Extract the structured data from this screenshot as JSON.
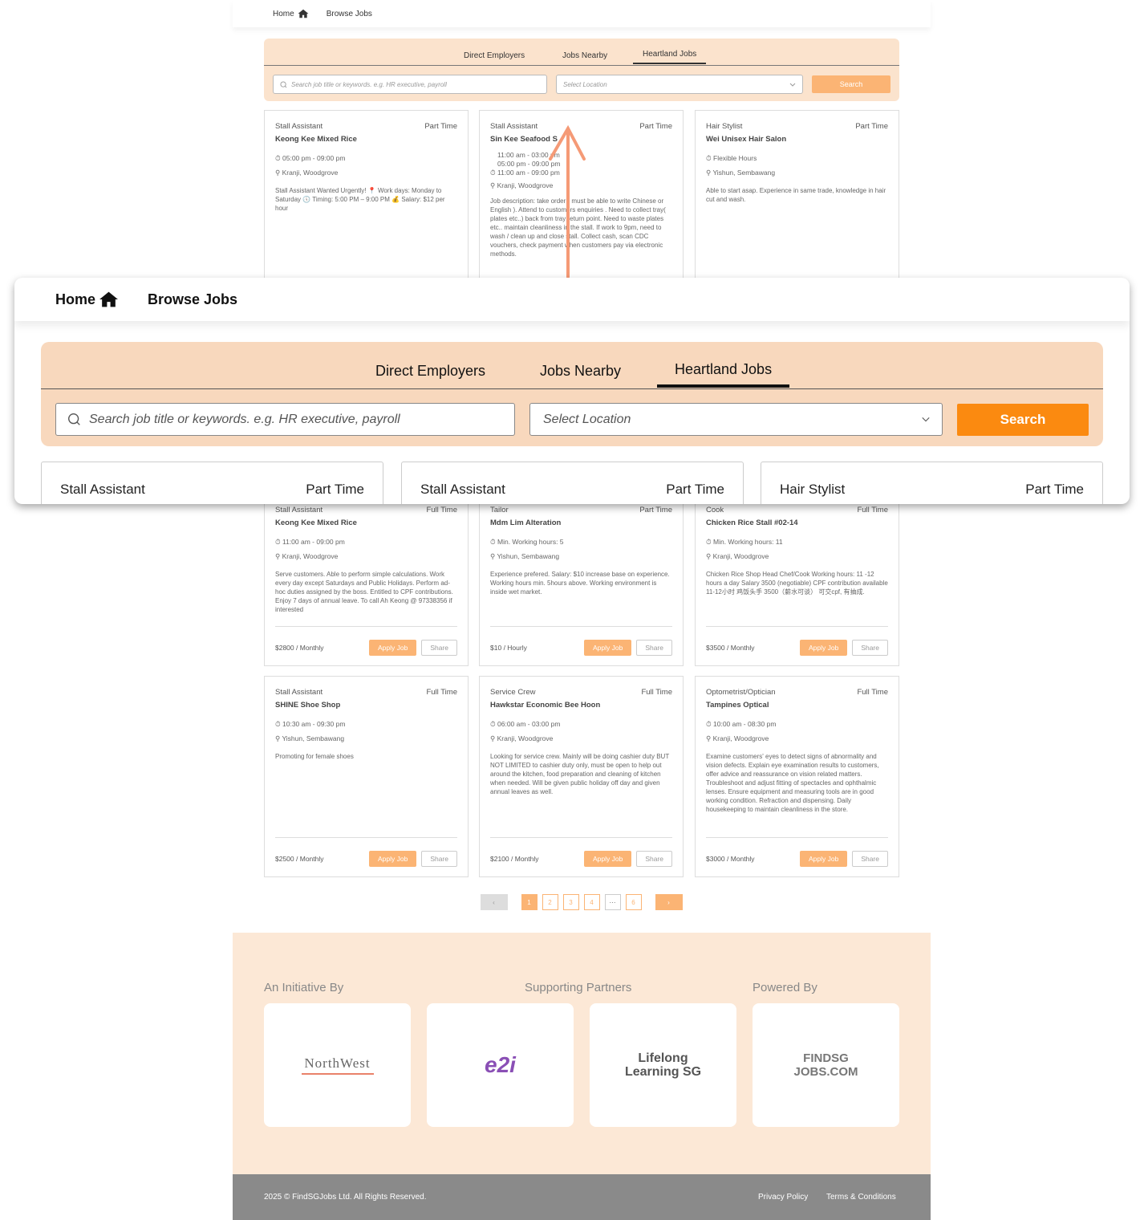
{
  "nav": {
    "home": "Home",
    "browse": "Browse Jobs"
  },
  "tabs": [
    "Direct Employers",
    "Jobs Nearby",
    "Heartland Jobs"
  ],
  "search": {
    "placeholder": "Search job title or keywords. e.g. HR executive, payroll",
    "location": "Select Location",
    "button": "Search"
  },
  "jobs": [
    {
      "title": "Stall Assistant",
      "type": "Part Time",
      "company": "Keong Kee Mixed Rice",
      "time": "05:00 pm - 09:00 pm",
      "location": "Kranji, Woodgrove",
      "desc": "Stall Assistant Wanted Urgently! 📍 Work days: Monday to Saturday 🕔 Timing: 5:00 PM – 9:00 PM 💰 Salary: $12 per hour"
    },
    {
      "title": "Stall Assistant",
      "type": "Part Time",
      "company": "Sin Kee Seafood S",
      "time": "11:00 am - 03:00 pm 05:00 pm - 09:00 pm 11:00 am - 09:00 pm",
      "location": "Kranji, Woodgrove",
      "desc": "Job description: take order ( must be able to write Chinese or English ). Attend to customers enquiries . Need to collect tray( plates etc..) back from tray return point. Need to waste plates etc.. maintain cleanliness in the stall. If work to 9pm, need to wash / clean up and close stall. Collect cash, scan CDC vouchers, check payment when customers pay via electronic methods."
    },
    {
      "title": "Hair Stylist",
      "type": "Part Time",
      "company": "Wei Unisex Hair Salon",
      "time": "Flexible Hours",
      "location": "Yishun, Sembawang",
      "desc": "Able to start asap. Experience in same trade, knowledge in hair cut and wash."
    },
    {
      "title": "Stall Assistant",
      "type": "Full Time",
      "company": "Keong Kee Mixed Rice",
      "time": "11:00 am - 09:00 pm",
      "location": "Kranji, Woodgrove",
      "desc": "Serve customers. Able to perform simple calculations. Work every day except Saturdays and Public Holidays. Perform ad-hoc duties assigned by the boss. Entitled to CPF contributions. Enjoy 7 days of annual leave. To call Ah Keong @ 97338356 if interested",
      "salary": "$2800",
      "period": "/ Monthly"
    },
    {
      "title": "Tailor",
      "type": "Part Time",
      "company": "Mdm Lim Alteration",
      "time": "Min. Working hours: 5",
      "location": "Yishun, Sembawang",
      "desc": "Experience prefered. Salary: $10 increase base on experience. Working hours min. 5hours above. Working environment is inside wet market.",
      "salary": "$10",
      "period": "/ Hourly"
    },
    {
      "title": "Cook",
      "type": "Full Time",
      "company": "Chicken Rice Stall #02-14",
      "time": "Min. Working hours: 11",
      "location": "Kranji, Woodgrove",
      "desc": "Chicken Rice Shop Head Chef/Cook Working hours: 11 -12 hours a day Salary 3500 (negotiable) CPF contribution available 11-12小时 鸡饭头手 3500（薪水可谈） 可交cpf, 有抽成.",
      "salary": "$3500",
      "period": "/ Monthly"
    },
    {
      "title": "Stall Assistant",
      "type": "Full Time",
      "company": "SHINE Shoe Shop",
      "time": "10:30 am - 09:30 pm",
      "location": "Yishun, Sembawang",
      "desc": "Promoting for female shoes",
      "salary": "$2500",
      "period": "/ Monthly"
    },
    {
      "title": "Service Crew",
      "type": "Full Time",
      "company": "Hawkstar Economic Bee Hoon",
      "time": "06:00 am - 03:00 pm",
      "location": "Kranji, Woodgrove",
      "desc": "Looking for service crew. Mainly will be doing cashier duty BUT NOT LIMITED to cashier duty only, must be open to help out around the kitchen, food preparation and cleaning of kitchen when needed. Will be given public holiday off day and given annual leaves as well.",
      "salary": "$2100",
      "period": "/ Monthly"
    },
    {
      "title": "Optometrist/Optician",
      "type": "Full Time",
      "company": "Tampines Optical",
      "time": "10:00 am - 08:30 pm",
      "location": "Kranji, Woodgrove",
      "desc": "Examine customers' eyes to detect signs of abnormality and vision defects. Explain eye examination results to customers, offer advice and reassurance on vision related matters. Troubleshoot and adjust fitting of spectacles and ophthalmic lenses. Ensure equipment and measuring tools are in good working condition. Refraction and dispensing. Daily housekeeping to maintain cleanliness in the store.",
      "salary": "$3000",
      "period": "/ Monthly"
    }
  ],
  "actions": {
    "apply": "Apply Job",
    "share": "Share"
  },
  "pagination": {
    "prev": "‹",
    "pages": [
      "1",
      "2",
      "3",
      "4",
      "···",
      "6"
    ],
    "next": "›"
  },
  "footer": {
    "initiative": "An Initiative By",
    "partners": "Supporting Partners",
    "powered": "Powered By",
    "logos": [
      "NorthWest",
      "e2i",
      "Lifelong Learning SG",
      "FINDSG JOBS.COM"
    ],
    "copyright": "2025 © FindSGJobs Ltd. All Rights Reserved.",
    "privacy": "Privacy Policy",
    "terms": "Terms & Conditions"
  },
  "zoom_cards": [
    {
      "title": "Stall Assistant",
      "type": "Part Time"
    },
    {
      "title": "Stall Assistant",
      "type": "Part Time"
    },
    {
      "title": "Hair Stylist",
      "type": "Part Time"
    }
  ],
  "colors": {
    "accent": "#fbb474",
    "accent_strong": "#fb8a10",
    "panel": "#fbe3cd",
    "footer_bar": "#8a8a8a"
  }
}
